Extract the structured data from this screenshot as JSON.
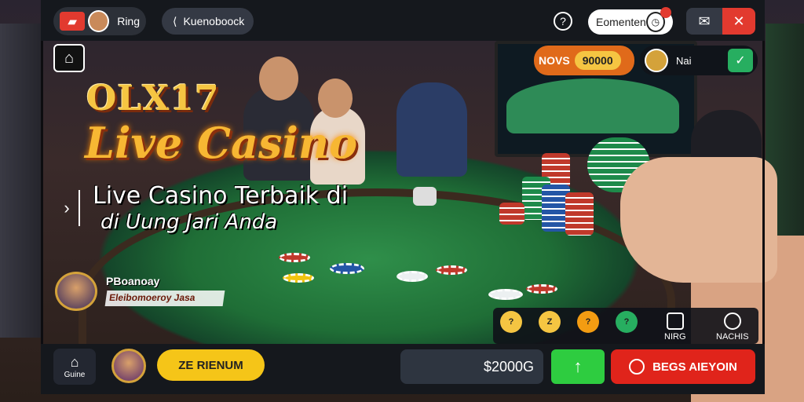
{
  "topbar": {
    "logo_label": "Ring",
    "back_label": "Kuenoboock",
    "notification_label": "Eomenten",
    "help_icon": "?",
    "gift_icon": "gift-icon",
    "close_icon": "✕"
  },
  "hero": {
    "title_line1": "OLX17",
    "title_line2": "Live Casino",
    "subtitle_line1": "Live Casino Terbaik di",
    "subtitle_line2": "di Uung Jari Anda"
  },
  "promo": {
    "title": "PBoanoay",
    "text": "Eleibomoeroy Jasa"
  },
  "odds": {
    "label": "NOVS",
    "value": "90000"
  },
  "stat": {
    "label": "Nai"
  },
  "games": {
    "icons": [
      "?",
      "Z",
      "?",
      "?"
    ],
    "button1_label": "NIRG",
    "button2_label": "NACHIS"
  },
  "bottombar": {
    "home_label": "Guine",
    "deposit_label": "ZE RIENUM",
    "balance": "$2000G",
    "up_icon": "↑",
    "bet_label": "BEGS AIEYOIN"
  },
  "colors": {
    "accent_gold": "#f5c518",
    "danger_red": "#e0241b",
    "success_green": "#2ecc40"
  }
}
